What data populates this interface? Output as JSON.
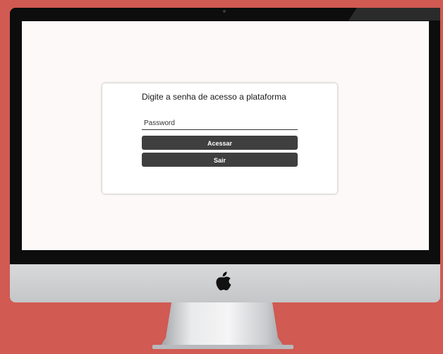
{
  "colors": {
    "background": "#d15a52",
    "bezel": "#0d0d0d",
    "screen": "#fdf9f9",
    "button": "#3f3f3f"
  },
  "icons": {
    "brand": "apple-icon"
  },
  "login": {
    "title": "Digite a senha de acesso a plataforma",
    "password_placeholder": "Password",
    "password_value": "",
    "access_label": "Acessar",
    "exit_label": "Sair"
  }
}
